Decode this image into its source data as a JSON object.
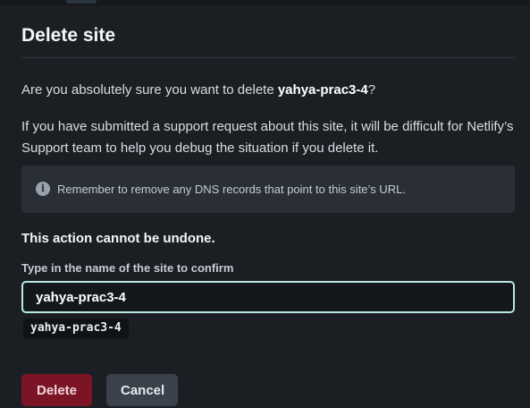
{
  "dialog": {
    "title": "Delete site",
    "question_prefix": "Are you absolutely sure you want to delete ",
    "site_name": "yahya-prac3-4",
    "question_suffix": "?",
    "support_text": "If you have submitted a support request about this site, it will be difficult for Netlify’s Support team to help you debug the situation if you delete it.",
    "callout": {
      "icon": "info-icon",
      "text": "Remember to remove any DNS records that point to this site’s URL."
    },
    "warning": "This action cannot be undone.",
    "confirm_field": {
      "label": "Type in the name of the site to confirm",
      "value": "yahya-prac3-4",
      "hint_code": "yahya-prac3-4"
    },
    "buttons": {
      "delete": "Delete",
      "cancel": "Cancel"
    }
  },
  "colors": {
    "background": "#1b1f24",
    "danger": "#7b1526",
    "input_focus_border": "#b7e9e0",
    "callout_bg": "#2a2f37"
  }
}
